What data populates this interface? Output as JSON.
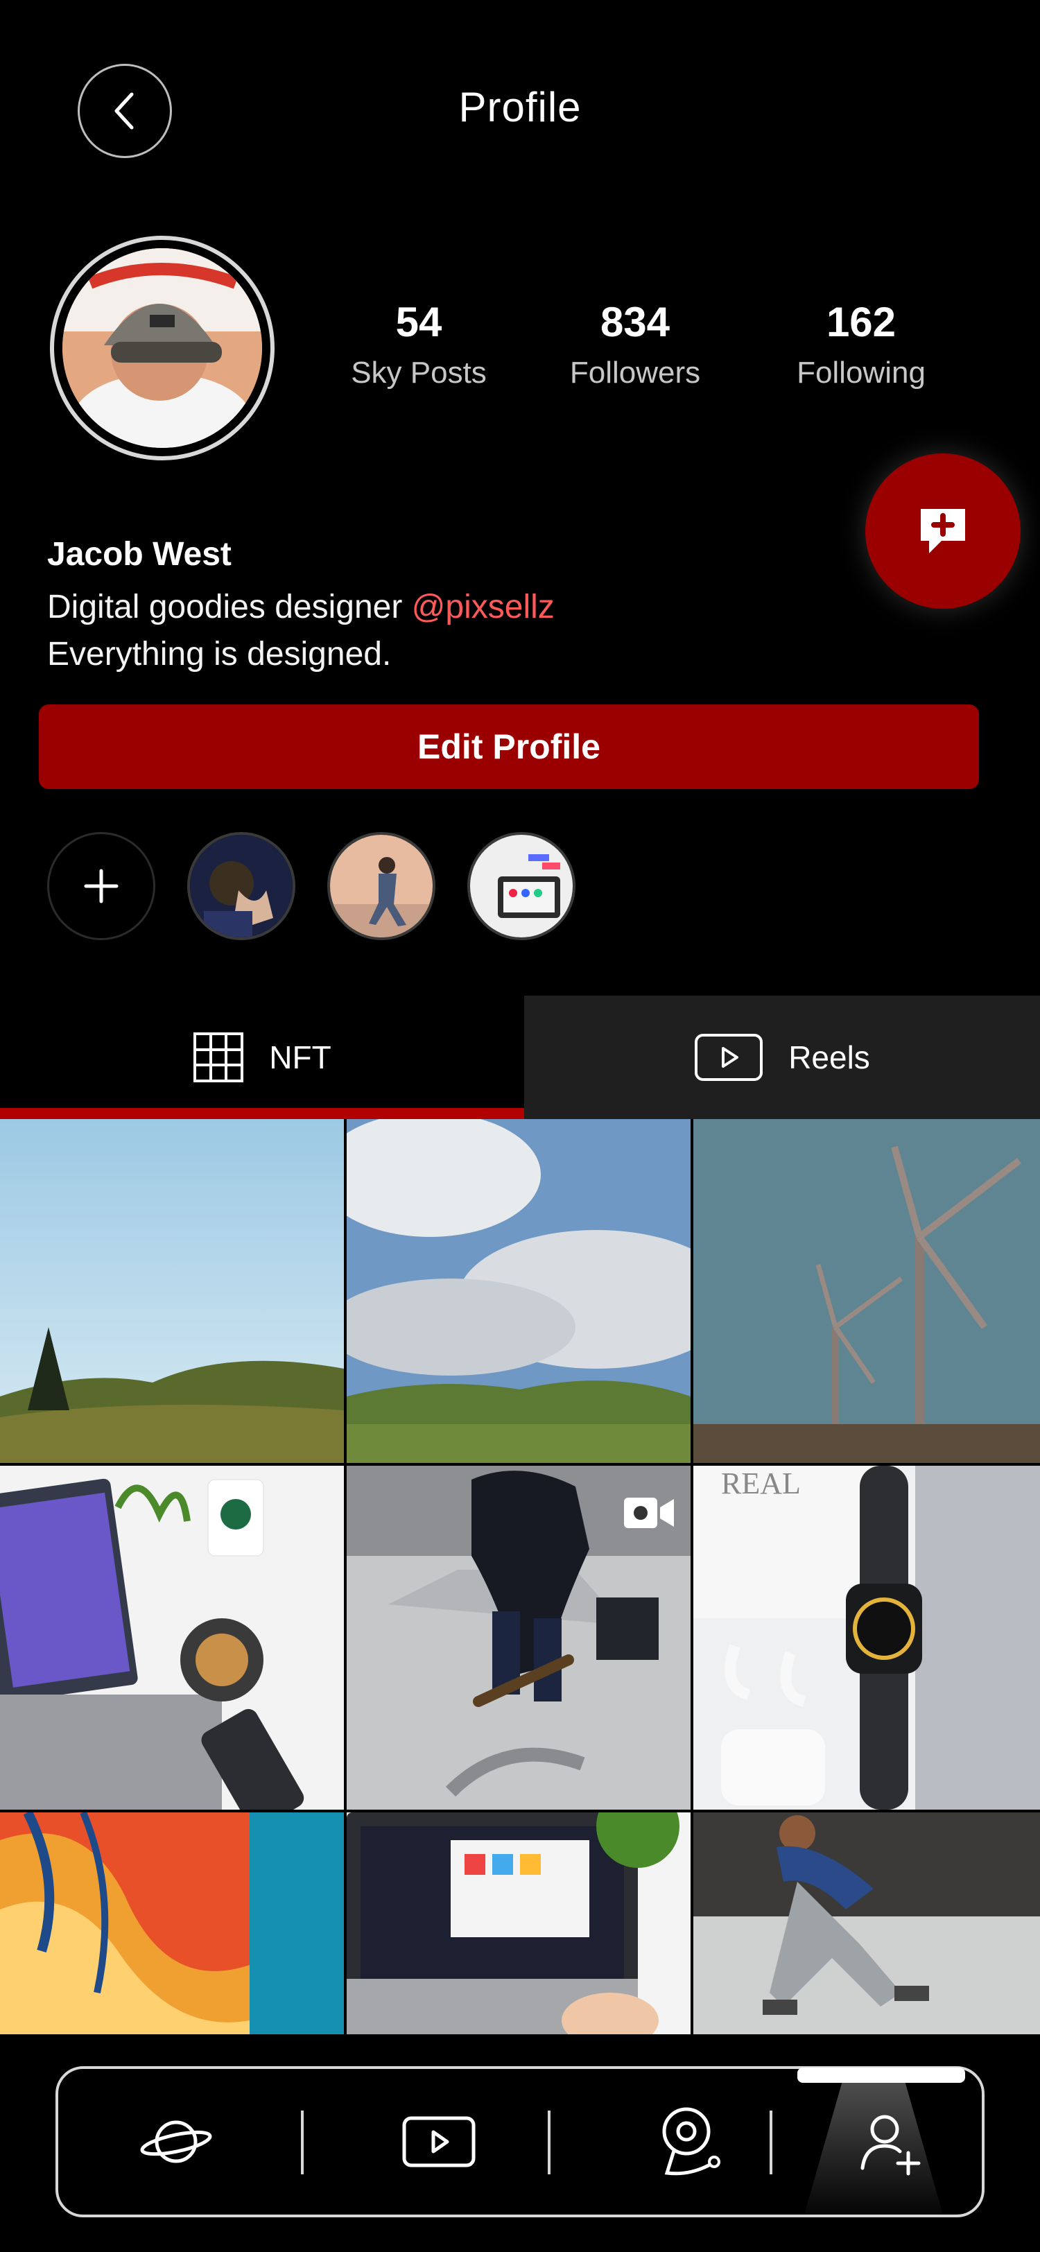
{
  "header": {
    "title": "Profile"
  },
  "stats": [
    {
      "value": "54",
      "label": "Sky Posts"
    },
    {
      "value": "834",
      "label": "Followers"
    },
    {
      "value": "162",
      "label": "Following"
    }
  ],
  "bio": {
    "name": "Jacob West",
    "line1_text": "Digital goodies designer ",
    "mention": "@pixsellz",
    "line2": "Everything is designed."
  },
  "actions": {
    "edit_profile": "Edit Profile"
  },
  "tabs": [
    {
      "label": "NFT",
      "active": true
    },
    {
      "label": "Reels",
      "active": false
    }
  ],
  "colors": {
    "accent": "#9a0000",
    "mention": "#ff5a5a",
    "background": "#000000"
  },
  "icons": {
    "back": "chevron-left-icon",
    "fab": "chat-plus-icon",
    "add_highlight": "plus-icon",
    "nft_tab": "grid-icon",
    "reels_tab": "play-icon",
    "nav": [
      "planet-icon",
      "play-icon",
      "location-icon",
      "add-user-icon"
    ]
  }
}
